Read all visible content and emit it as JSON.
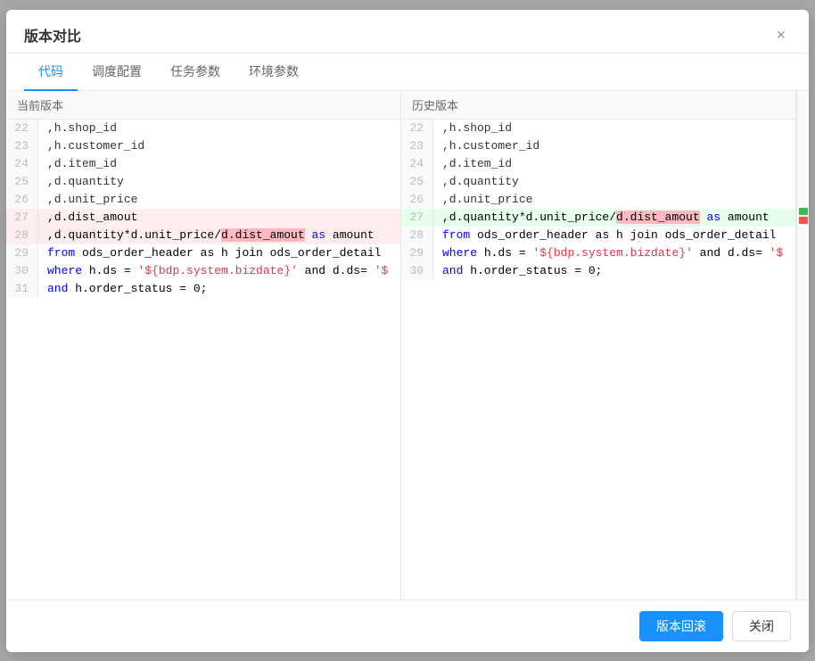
{
  "modal": {
    "title": "版本对比",
    "close_label": "×"
  },
  "tabs": [
    {
      "label": "代码",
      "active": true
    },
    {
      "label": "调度配置",
      "active": false
    },
    {
      "label": "任务参数",
      "active": false
    },
    {
      "label": "环境参数",
      "active": false
    }
  ],
  "panels": {
    "left": {
      "header": "当前版本",
      "lines": [
        {
          "num": "22",
          "text": ",h.shop_id",
          "type": "normal"
        },
        {
          "num": "23",
          "text": ",h.customer_id",
          "type": "normal"
        },
        {
          "num": "24",
          "text": ",d.item_id",
          "type": "normal"
        },
        {
          "num": "25",
          "text": ",d.quantity",
          "type": "normal"
        },
        {
          "num": "26",
          "text": ",d.unit_price",
          "type": "normal"
        },
        {
          "num": "27",
          "text": ",d.dist_amout",
          "type": "removed"
        },
        {
          "num": "28",
          "text": ",d.quantity*d.unit_price/d.dist_amout as amount",
          "type": "removed"
        },
        {
          "num": "29",
          "text": "from ods_order_header as h join ods_order_detail",
          "type": "normal"
        },
        {
          "num": "30",
          "text": "where h.ds = '${bdp.system.bizdate}' and d.ds= '$",
          "type": "normal"
        },
        {
          "num": "31",
          "text": "and h.order_status = 0;",
          "type": "normal"
        }
      ]
    },
    "right": {
      "header": "历史版本",
      "lines": [
        {
          "num": "22",
          "text": ",h.shop_id",
          "type": "normal"
        },
        {
          "num": "23",
          "text": ",h.customer_id",
          "type": "normal"
        },
        {
          "num": "24",
          "text": ",d.item_id",
          "type": "normal"
        },
        {
          "num": "25",
          "text": ",d.quantity",
          "type": "normal"
        },
        {
          "num": "26",
          "text": ",d.unit_price",
          "type": "normal"
        },
        {
          "num": "27",
          "text": ",d.quantity*d.unit_price/d.dist_amout as amount",
          "type": "added"
        },
        {
          "num": "28",
          "text": "from ods_order_header as h join ods_order_detail",
          "type": "normal"
        },
        {
          "num": "29",
          "text": "where h.ds = '${bdp.system.bizdate}' and d.ds= '$",
          "type": "normal"
        },
        {
          "num": "30",
          "text": "and h.order_status = 0;",
          "type": "normal"
        }
      ]
    }
  },
  "footer": {
    "rollback_label": "版本回滚",
    "close_label": "关闭"
  }
}
